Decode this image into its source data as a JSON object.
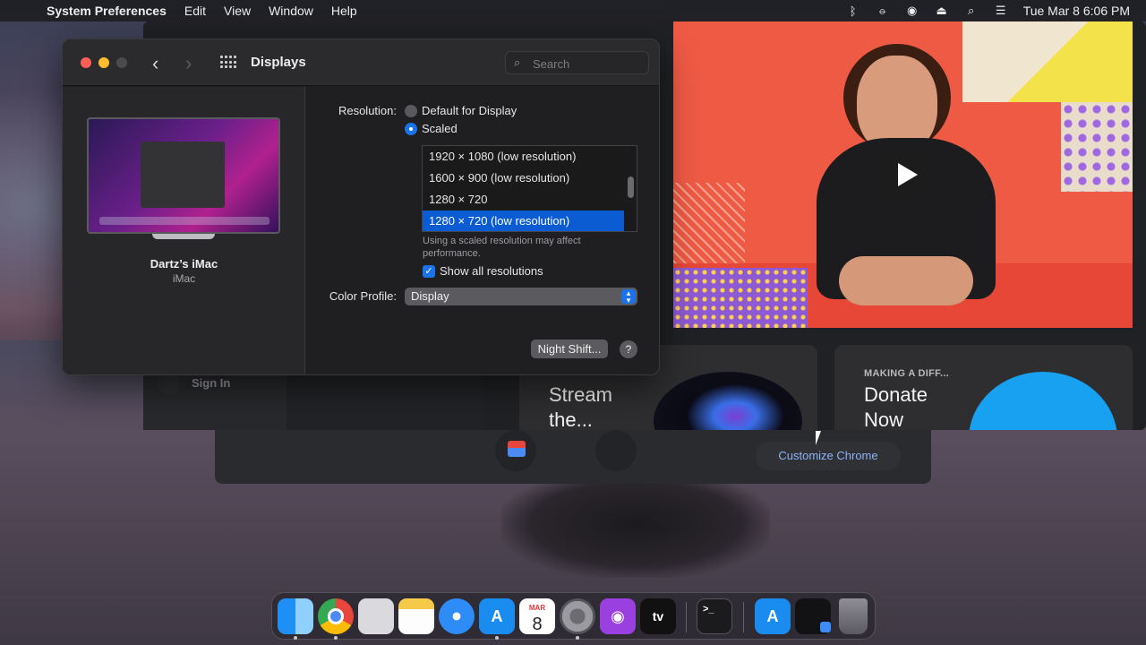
{
  "menubar": {
    "app_name": "System Preferences",
    "menus": [
      "Edit",
      "View",
      "Window",
      "Help"
    ],
    "clock": "Tue Mar 8  6:06 PM",
    "status_icons": [
      "bluetooth-icon",
      "airdrop-icon",
      "user-icon",
      "eject-icon",
      "search-icon",
      "control-center-icon"
    ]
  },
  "prefs": {
    "title": "Displays",
    "search_placeholder": "Search",
    "display_name": "Dartz’s iMac",
    "display_model": "iMac",
    "resolution_label": "Resolution:",
    "radio_default": "Default for Display",
    "radio_scaled": "Scaled",
    "resolutions": [
      "1920 × 1080 (low resolution)",
      "1600 × 900 (low resolution)",
      "1280 × 720",
      "1280 × 720 (low resolution)"
    ],
    "selected_resolution": "1280 × 720 (low resolution)",
    "perf_note": "Using a scaled resolution may affect performance.",
    "show_all_label": "Show all resolutions",
    "color_profile_label": "Color Profile:",
    "color_profile_value": "Display",
    "night_shift_label": "Night Shift...",
    "help_label": "?"
  },
  "browser": {
    "sign_in": "Sign In",
    "customize_label": "Customize Chrome",
    "cards": [
      {
        "eyebrow": "",
        "title": "Stream the..."
      },
      {
        "eyebrow": "MAKING A DIFF...",
        "title": "Donate Now"
      }
    ]
  },
  "dock": {
    "calendar_month": "MAR",
    "calendar_day": "8",
    "tv_label": "tv",
    "terminal_label": ">_"
  },
  "colors": {
    "accent": "#1a73e8",
    "close": "#ff5f57",
    "minimize": "#febc2e",
    "video_bg": "#ef5a45"
  }
}
